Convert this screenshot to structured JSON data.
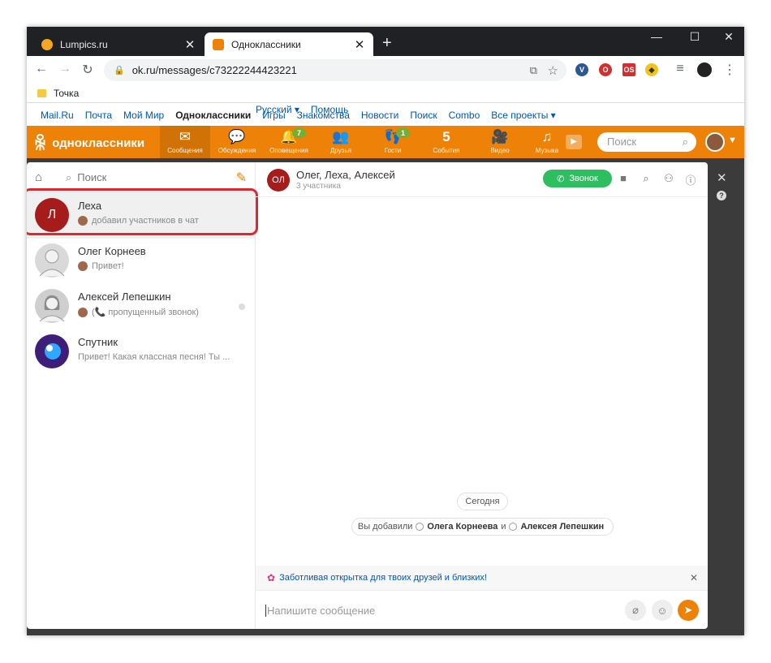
{
  "browser": {
    "tabs": [
      {
        "title": "Lumpics.ru",
        "favicon_color": "#f5a623"
      },
      {
        "title": "Одноклассники",
        "favicon_color": "#ee8208"
      }
    ],
    "url": "ok.ru/messages/c73222244423221",
    "bookmark": "Точка"
  },
  "mailbar": {
    "links": [
      "Mail.Ru",
      "Почта",
      "Мой Мир",
      "Одноклассники",
      "Игры",
      "Знакомства",
      "Новости",
      "Поиск",
      "Combo",
      "Все проекты ▾"
    ],
    "language": "Русский ▾",
    "help": "Помощь"
  },
  "ok": {
    "logo": "одноклассники",
    "nav": [
      {
        "label": "Сообщения",
        "icon": "✉",
        "badge": ""
      },
      {
        "label": "Обсуждения",
        "icon": "💬",
        "badge": ""
      },
      {
        "label": "Оповещения",
        "icon": "🔔",
        "badge": "7"
      },
      {
        "label": "Друзья",
        "icon": "👥",
        "badge": ""
      },
      {
        "label": "Гости",
        "icon": "👣",
        "badge": "1"
      },
      {
        "label": "События",
        "icon": "5",
        "badge": ""
      },
      {
        "label": "Видео",
        "icon": "🎥",
        "badge": ""
      },
      {
        "label": "Музыка",
        "icon": "♫",
        "badge": ""
      }
    ],
    "search_placeholder": "Поиск"
  },
  "sidebar": {
    "search_placeholder": "Поиск",
    "conversations": [
      {
        "initial": "Л",
        "name": "Леха",
        "preview": "добавил участников в чат",
        "avatar_color": "#a61b1b"
      },
      {
        "initial": "",
        "name": "Олег Корнеев",
        "preview": "Привет!",
        "avatar_color": "#d9d9d9"
      },
      {
        "initial": "",
        "name": "Алексей Лепешкин",
        "preview": "(📞 пропущенный звонок)",
        "avatar_color": "#cfcfcf"
      },
      {
        "initial": "",
        "name": "Спутник",
        "preview": "Привет! Какая классная песня! Ты ...",
        "avatar_color": "#3d1f7a"
      }
    ]
  },
  "chat": {
    "avatar": "ОЛ",
    "title": "Олег, Леха, Алексей",
    "subtitle": "3 участника",
    "call_label": "Звонок",
    "date_pill": "Сегодня",
    "system_prefix": "Вы добавили",
    "system_user1": "Олега Корнеева",
    "system_and": "и",
    "system_user2": "Алексея Лепешкин",
    "promo": "Заботливая открытка для твоих друзей и близких!",
    "composer_placeholder": "Напишите сообщение"
  }
}
